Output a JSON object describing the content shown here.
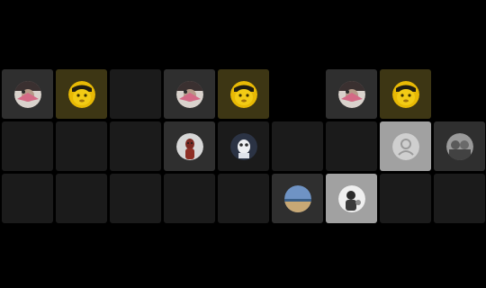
{
  "grids": [
    {
      "name": "grid-left",
      "cells": [
        {
          "type": "avatar-pink",
          "tone": "grey"
        },
        {
          "type": "avatar-yellow",
          "tone": "yellow"
        },
        {
          "type": "empty-slot",
          "tone": "dark"
        },
        {
          "type": "empty-slot",
          "tone": "dark"
        },
        {
          "type": "empty-slot",
          "tone": "dark"
        },
        {
          "type": "empty-slot",
          "tone": "dark"
        },
        {
          "type": "empty-slot",
          "tone": "dark"
        },
        {
          "type": "empty-slot",
          "tone": "dark"
        },
        {
          "type": "empty-slot",
          "tone": "dark"
        }
      ]
    },
    {
      "name": "grid-middle",
      "cells": [
        {
          "type": "avatar-pink",
          "tone": "grey"
        },
        {
          "type": "avatar-yellow",
          "tone": "yellow"
        },
        {
          "type": "none",
          "tone": "empty"
        },
        {
          "type": "avatar-red",
          "tone": "grey"
        },
        {
          "type": "avatar-white",
          "tone": "dark"
        },
        {
          "type": "empty-slot",
          "tone": "dark"
        },
        {
          "type": "empty-slot",
          "tone": "dark"
        },
        {
          "type": "empty-slot",
          "tone": "dark"
        },
        {
          "type": "avatar-landscape",
          "tone": "grey"
        }
      ]
    },
    {
      "name": "grid-right",
      "cells": [
        {
          "type": "avatar-pink",
          "tone": "grey"
        },
        {
          "type": "avatar-yellow",
          "tone": "yellow"
        },
        {
          "type": "none",
          "tone": "empty"
        },
        {
          "type": "empty-slot",
          "tone": "dark"
        },
        {
          "type": "default-user",
          "tone": "light"
        },
        {
          "type": "avatar-group",
          "tone": "grey"
        },
        {
          "type": "avatar-bw",
          "tone": "light"
        },
        {
          "type": "empty-slot",
          "tone": "dark"
        },
        {
          "type": "empty-slot",
          "tone": "dark"
        }
      ]
    }
  ],
  "colors": {
    "background": "#000000",
    "cell_dark": "#1b1b1b",
    "cell_grey": "#2f2f2f",
    "cell_yellow": "#3d3614",
    "cell_light": "#a1a1a1"
  }
}
